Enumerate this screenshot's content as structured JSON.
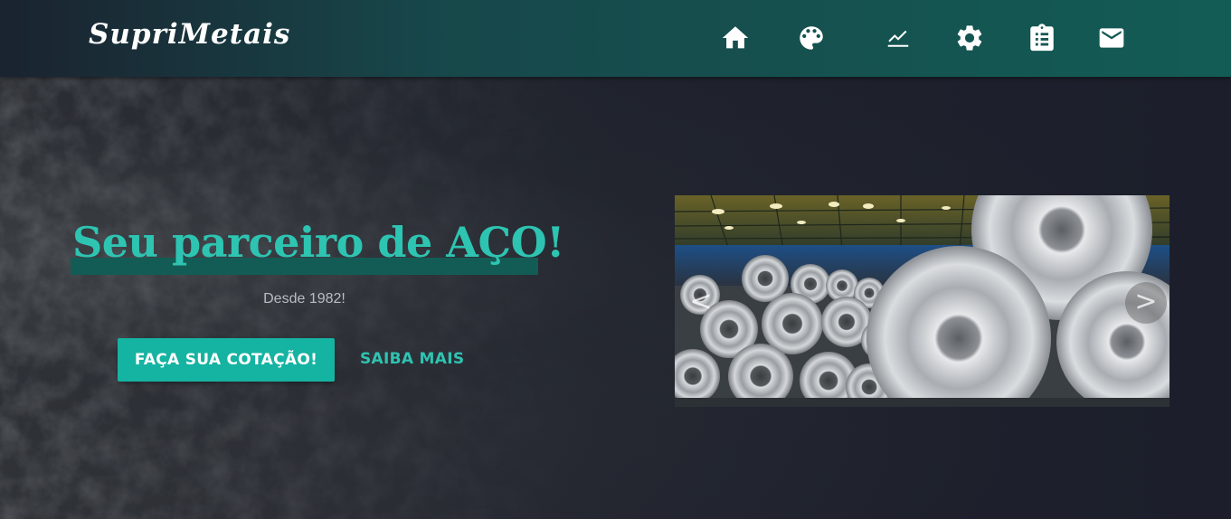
{
  "navbar": {
    "brand": "SupriMetais",
    "icons": [
      {
        "name": "home-icon",
        "label": "Home"
      },
      {
        "name": "palette-icon",
        "label": "Produtos"
      },
      {
        "name": "chart-line-icon",
        "label": "Mercado"
      },
      {
        "name": "gear-icon",
        "label": "Serviços"
      },
      {
        "name": "clipboard-icon",
        "label": "Cotação"
      },
      {
        "name": "mail-icon",
        "label": "Contato"
      }
    ]
  },
  "hero": {
    "headline": "Seu parceiro de AÇO!",
    "subtitle": "Desde 1982!",
    "primary_button": "FAÇA SUA COTAÇÃO!",
    "secondary_link": "SAIBA MAIS",
    "carousel": {
      "image": "steel-coils-warehouse",
      "prev_label": "<",
      "next_label": ">"
    }
  },
  "colors": {
    "accent": "#2ec4b2",
    "button": "#15b3a2",
    "nav_dark": "#1a2330",
    "nav_teal": "#135c55",
    "background": "#1c1f2b"
  }
}
